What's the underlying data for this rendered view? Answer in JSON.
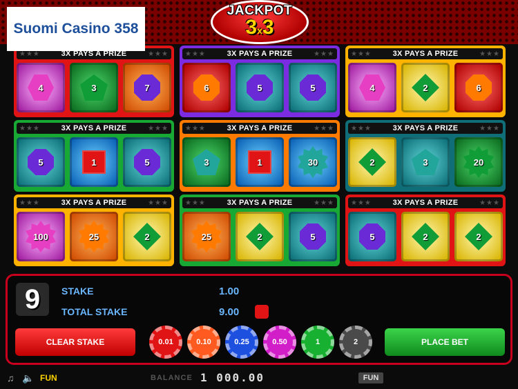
{
  "brand": {
    "name": "Suomi Casino 358"
  },
  "logo": {
    "line1": "JACKPOT",
    "line2_a": "3",
    "line2_x": "x",
    "line2_b": "3"
  },
  "tickets": [
    {
      "banner": "3X PAYS A PRIZE",
      "border": "#e01414",
      "cells": [
        {
          "bg": "pink",
          "shape": "hex",
          "color": "pink",
          "value": "4"
        },
        {
          "bg": "green",
          "shape": "pentagon",
          "color": "green",
          "value": "3"
        },
        {
          "bg": "orange",
          "shape": "octagon",
          "color": "purple",
          "value": "7"
        }
      ]
    },
    {
      "banner": "3X PAYS A PRIZE",
      "border": "#7b2be0",
      "cells": [
        {
          "bg": "red",
          "shape": "octagon",
          "color": "orange",
          "value": "6"
        },
        {
          "bg": "teal",
          "shape": "octagon",
          "color": "purple",
          "value": "5"
        },
        {
          "bg": "teal",
          "shape": "octagon",
          "color": "purple",
          "value": "5"
        }
      ]
    },
    {
      "banner": "3X PAYS A PRIZE",
      "border": "#ffb300",
      "cells": [
        {
          "bg": "pink",
          "shape": "hex",
          "color": "pink",
          "value": "4"
        },
        {
          "bg": "yellow",
          "shape": "diamond",
          "color": "green",
          "value": "2"
        },
        {
          "bg": "red",
          "shape": "octagon",
          "color": "orange",
          "value": "6"
        }
      ]
    },
    {
      "banner": "3X PAYS A PRIZE",
      "border": "#18a834",
      "cells": [
        {
          "bg": "teal",
          "shape": "octagon",
          "color": "purple",
          "value": "5"
        },
        {
          "bg": "blue",
          "shape": "square",
          "color": "red",
          "value": "1"
        },
        {
          "bg": "teal",
          "shape": "octagon",
          "color": "purple",
          "value": "5"
        }
      ]
    },
    {
      "banner": "3X PAYS A PRIZE",
      "border": "#ff7a00",
      "cells": [
        {
          "bg": "green",
          "shape": "pentagon",
          "color": "teal",
          "value": "3"
        },
        {
          "bg": "blue",
          "shape": "square",
          "color": "red",
          "value": "1"
        },
        {
          "bg": "blue",
          "shape": "star",
          "color": "teal",
          "value": "30"
        }
      ]
    },
    {
      "banner": "3X PAYS A PRIZE",
      "border": "#0f6e78",
      "cells": [
        {
          "bg": "yellow",
          "shape": "diamond",
          "color": "green",
          "value": "2"
        },
        {
          "bg": "teal",
          "shape": "pentagon",
          "color": "teal",
          "value": "3"
        },
        {
          "bg": "green",
          "shape": "star",
          "color": "green",
          "value": "20"
        }
      ]
    },
    {
      "banner": "3X PAYS A PRIZE",
      "border": "#ffb300",
      "cells": [
        {
          "bg": "pink",
          "shape": "star",
          "color": "pink",
          "value": "100"
        },
        {
          "bg": "orange",
          "shape": "star",
          "color": "orange",
          "value": "25"
        },
        {
          "bg": "yellow",
          "shape": "diamond",
          "color": "green",
          "value": "2"
        }
      ]
    },
    {
      "banner": "3X PAYS A PRIZE",
      "border": "#18a834",
      "cells": [
        {
          "bg": "orange",
          "shape": "star",
          "color": "orange",
          "value": "25"
        },
        {
          "bg": "yellow",
          "shape": "diamond",
          "color": "green",
          "value": "2"
        },
        {
          "bg": "teal",
          "shape": "octagon",
          "color": "purple",
          "value": "5"
        }
      ]
    },
    {
      "banner": "3X PAYS A PRIZE",
      "border": "#e01414",
      "cells": [
        {
          "bg": "teal",
          "shape": "octagon",
          "color": "purple",
          "value": "5"
        },
        {
          "bg": "yellow",
          "shape": "diamond",
          "color": "green",
          "value": "2"
        },
        {
          "bg": "yellow",
          "shape": "diamond",
          "color": "green",
          "value": "2"
        }
      ]
    }
  ],
  "controls": {
    "ticket_count": "9",
    "stake_label": "STAKE",
    "stake_value": "1.00",
    "total_stake_label": "TOTAL STAKE",
    "total_stake_value": "9.00",
    "clear_label": "CLEAR STAKE",
    "place_label": "PLACE BET",
    "chips": [
      {
        "value": "0.01",
        "color": "#e01414"
      },
      {
        "value": "0.10",
        "color": "#ff5a1f"
      },
      {
        "value": "0.25",
        "color": "#1e50e0"
      },
      {
        "value": "0.50",
        "color": "#d21ec8"
      },
      {
        "value": "1",
        "color": "#18b030"
      },
      {
        "value": "2",
        "color": "#4a4a4a"
      }
    ]
  },
  "status": {
    "mode": "FUN",
    "balance_label": "BALANCE",
    "balance_value": "1 000.00",
    "mode_badge": "FUN"
  }
}
